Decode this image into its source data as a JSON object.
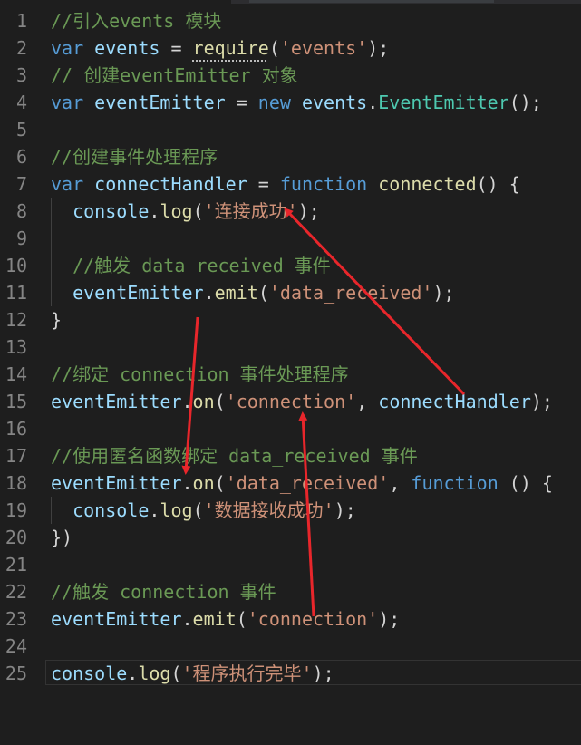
{
  "editor": {
    "lines": [
      {
        "n": "1",
        "tokens": [
          {
            "t": "//引入events 模块",
            "c": "comment"
          }
        ]
      },
      {
        "n": "2",
        "tokens": [
          {
            "t": "var",
            "c": "kw"
          },
          {
            "t": " ",
            "c": "plain"
          },
          {
            "t": "events",
            "c": "ident"
          },
          {
            "t": " = ",
            "c": "plain"
          },
          {
            "t": "require",
            "c": "fn"
          },
          {
            "t": "(",
            "c": "plain"
          },
          {
            "t": "'events'",
            "c": "str"
          },
          {
            "t": ");",
            "c": "plain"
          }
        ]
      },
      {
        "n": "3",
        "tokens": [
          {
            "t": "// 创建eventEmitter 对象",
            "c": "comment"
          }
        ]
      },
      {
        "n": "4",
        "tokens": [
          {
            "t": "var",
            "c": "kw"
          },
          {
            "t": " ",
            "c": "plain"
          },
          {
            "t": "eventEmitter",
            "c": "ident"
          },
          {
            "t": " = ",
            "c": "plain"
          },
          {
            "t": "new",
            "c": "kw"
          },
          {
            "t": " ",
            "c": "plain"
          },
          {
            "t": "events",
            "c": "ident"
          },
          {
            "t": ".",
            "c": "plain"
          },
          {
            "t": "EventEmitter",
            "c": "cls"
          },
          {
            "t": "();",
            "c": "plain"
          }
        ]
      },
      {
        "n": "5",
        "tokens": []
      },
      {
        "n": "6",
        "tokens": [
          {
            "t": "//创建事件处理程序",
            "c": "comment"
          }
        ]
      },
      {
        "n": "7",
        "tokens": [
          {
            "t": "var",
            "c": "kw"
          },
          {
            "t": " ",
            "c": "plain"
          },
          {
            "t": "connectHandler",
            "c": "ident"
          },
          {
            "t": " = ",
            "c": "plain"
          },
          {
            "t": "function",
            "c": "kw"
          },
          {
            "t": " ",
            "c": "plain"
          },
          {
            "t": "connected",
            "c": "fn"
          },
          {
            "t": "() {",
            "c": "plain"
          }
        ]
      },
      {
        "n": "8",
        "tokens": [
          {
            "t": "  ",
            "c": "plain"
          },
          {
            "t": "console",
            "c": "ident"
          },
          {
            "t": ".",
            "c": "plain"
          },
          {
            "t": "log",
            "c": "fn"
          },
          {
            "t": "(",
            "c": "plain"
          },
          {
            "t": "'连接成功'",
            "c": "str"
          },
          {
            "t": ");",
            "c": "plain"
          }
        ]
      },
      {
        "n": "9",
        "tokens": []
      },
      {
        "n": "10",
        "tokens": [
          {
            "t": "  ",
            "c": "plain"
          },
          {
            "t": "//触发 data_received 事件",
            "c": "comment"
          }
        ]
      },
      {
        "n": "11",
        "tokens": [
          {
            "t": "  ",
            "c": "plain"
          },
          {
            "t": "eventEmitter",
            "c": "ident"
          },
          {
            "t": ".",
            "c": "plain"
          },
          {
            "t": "emit",
            "c": "fn"
          },
          {
            "t": "(",
            "c": "plain"
          },
          {
            "t": "'data_received'",
            "c": "str"
          },
          {
            "t": ");",
            "c": "plain"
          }
        ]
      },
      {
        "n": "12",
        "tokens": [
          {
            "t": "}",
            "c": "plain"
          }
        ]
      },
      {
        "n": "13",
        "tokens": []
      },
      {
        "n": "14",
        "tokens": [
          {
            "t": "//绑定 connection 事件处理程序",
            "c": "comment"
          }
        ]
      },
      {
        "n": "15",
        "tokens": [
          {
            "t": "eventEmitter",
            "c": "ident"
          },
          {
            "t": ".",
            "c": "plain"
          },
          {
            "t": "on",
            "c": "fn"
          },
          {
            "t": "(",
            "c": "plain"
          },
          {
            "t": "'connection'",
            "c": "str"
          },
          {
            "t": ", ",
            "c": "plain"
          },
          {
            "t": "connectHandler",
            "c": "ident"
          },
          {
            "t": ");",
            "c": "plain"
          }
        ]
      },
      {
        "n": "16",
        "tokens": []
      },
      {
        "n": "17",
        "tokens": [
          {
            "t": "//使用匿名函数绑定 data_received 事件",
            "c": "comment"
          }
        ]
      },
      {
        "n": "18",
        "tokens": [
          {
            "t": "eventEmitter",
            "c": "ident"
          },
          {
            "t": ".",
            "c": "plain"
          },
          {
            "t": "on",
            "c": "fn"
          },
          {
            "t": "(",
            "c": "plain"
          },
          {
            "t": "'data_received'",
            "c": "str"
          },
          {
            "t": ", ",
            "c": "plain"
          },
          {
            "t": "function",
            "c": "kw"
          },
          {
            "t": " () {",
            "c": "plain"
          }
        ]
      },
      {
        "n": "19",
        "tokens": [
          {
            "t": "  ",
            "c": "plain"
          },
          {
            "t": "console",
            "c": "ident"
          },
          {
            "t": ".",
            "c": "plain"
          },
          {
            "t": "log",
            "c": "fn"
          },
          {
            "t": "(",
            "c": "plain"
          },
          {
            "t": "'数据接收成功'",
            "c": "str"
          },
          {
            "t": ");",
            "c": "plain"
          }
        ]
      },
      {
        "n": "20",
        "tokens": [
          {
            "t": "})",
            "c": "plain"
          }
        ]
      },
      {
        "n": "21",
        "tokens": []
      },
      {
        "n": "22",
        "tokens": [
          {
            "t": "//触发 connection 事件",
            "c": "comment"
          }
        ]
      },
      {
        "n": "23",
        "tokens": [
          {
            "t": "eventEmitter",
            "c": "ident"
          },
          {
            "t": ".",
            "c": "plain"
          },
          {
            "t": "emit",
            "c": "fn"
          },
          {
            "t": "(",
            "c": "plain"
          },
          {
            "t": "'connection'",
            "c": "str"
          },
          {
            "t": ");",
            "c": "plain"
          }
        ]
      },
      {
        "n": "24",
        "tokens": []
      },
      {
        "n": "25",
        "tokens": [
          {
            "t": "console",
            "c": "ident"
          },
          {
            "t": ".",
            "c": "plain"
          },
          {
            "t": "log",
            "c": "fn"
          },
          {
            "t": "(",
            "c": "plain"
          },
          {
            "t": "'程序执行完毕'",
            "c": "str"
          },
          {
            "t": ");",
            "c": "plain"
          }
        ]
      }
    ],
    "colors": {
      "background": "#1e1e1e",
      "comment": "#6a9955",
      "keyword": "#569cd6",
      "identifier": "#9cdcfe",
      "string": "#ce9178",
      "function": "#dcdcaa",
      "class": "#4ec9b0",
      "annotation_arrow": "#e8262b"
    },
    "annotation_arrows": [
      {
        "name": "arrow-connecthandler-to-log-success"
      },
      {
        "name": "arrow-emit-data-received-to-on-data-received"
      },
      {
        "name": "arrow-emit-connection-to-on-connection"
      }
    ]
  }
}
